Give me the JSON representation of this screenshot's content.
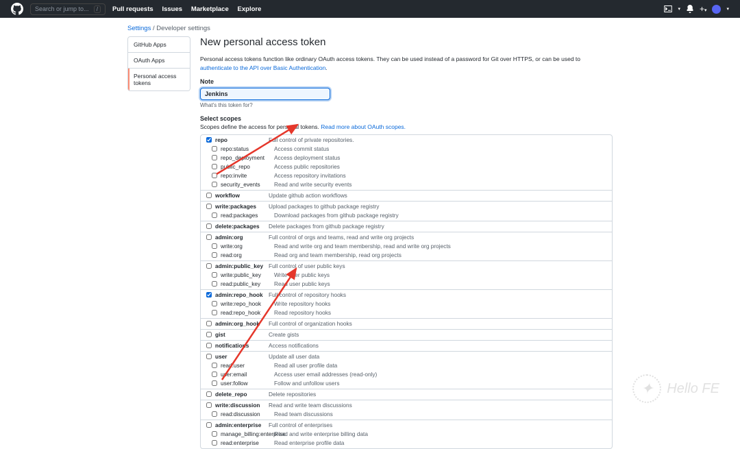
{
  "header": {
    "search_placeholder": "Search or jump to...",
    "nav": [
      "Pull requests",
      "Issues",
      "Marketplace",
      "Explore"
    ]
  },
  "breadcrumb": {
    "settings": "Settings",
    "sep": "/",
    "current": "Developer settings"
  },
  "sidebar": {
    "items": [
      "GitHub Apps",
      "OAuth Apps",
      "Personal access tokens"
    ]
  },
  "page": {
    "title": "New personal access token",
    "desc1": "Personal access tokens function like ordinary OAuth access tokens. They can be used instead of a password for Git over HTTPS, or can be used to ",
    "desc_link": "authenticate to the API over Basic Authentication",
    "desc_end": ".",
    "note_label": "Note",
    "note_value": "Jenkins",
    "note_hint": "What's this token for?",
    "select_scopes": "Select scopes",
    "scopes_desc": "Scopes define the access for personal tokens. ",
    "scopes_link": "Read more about OAuth scopes."
  },
  "scopes": [
    {
      "name": "repo",
      "desc": "Full control of private repositories.",
      "checked": true,
      "children": [
        {
          "name": "repo:status",
          "desc": "Access commit status"
        },
        {
          "name": "repo_deployment",
          "desc": "Access deployment status"
        },
        {
          "name": "public_repo",
          "desc": "Access public repositories"
        },
        {
          "name": "repo:invite",
          "desc": "Access repository invitations"
        },
        {
          "name": "security_events",
          "desc": "Read and write security events"
        }
      ]
    },
    {
      "name": "workflow",
      "desc": "Update github action workflows"
    },
    {
      "name": "write:packages",
      "desc": "Upload packages to github package registry",
      "children": [
        {
          "name": "read:packages",
          "desc": "Download packages from github package registry"
        }
      ]
    },
    {
      "name": "delete:packages",
      "desc": "Delete packages from github package registry"
    },
    {
      "name": "admin:org",
      "desc": "Full control of orgs and teams, read and write org projects",
      "children": [
        {
          "name": "write:org",
          "desc": "Read and write org and team membership, read and write org projects"
        },
        {
          "name": "read:org",
          "desc": "Read org and team membership, read org projects"
        }
      ]
    },
    {
      "name": "admin:public_key",
      "desc": "Full control of user public keys",
      "children": [
        {
          "name": "write:public_key",
          "desc": "Write user public keys"
        },
        {
          "name": "read:public_key",
          "desc": "Read user public keys"
        }
      ]
    },
    {
      "name": "admin:repo_hook",
      "desc": "Full control of repository hooks",
      "checked": true,
      "children": [
        {
          "name": "write:repo_hook",
          "desc": "Write repository hooks"
        },
        {
          "name": "read:repo_hook",
          "desc": "Read repository hooks"
        }
      ]
    },
    {
      "name": "admin:org_hook",
      "desc": "Full control of organization hooks"
    },
    {
      "name": "gist",
      "desc": "Create gists"
    },
    {
      "name": "notifications",
      "desc": "Access notifications"
    },
    {
      "name": "user",
      "desc": "Update all user data",
      "children": [
        {
          "name": "read:user",
          "desc": "Read all user profile data"
        },
        {
          "name": "user:email",
          "desc": "Access user email addresses (read-only)"
        },
        {
          "name": "user:follow",
          "desc": "Follow and unfollow users"
        }
      ]
    },
    {
      "name": "delete_repo",
      "desc": "Delete repositories"
    },
    {
      "name": "write:discussion",
      "desc": "Read and write team discussions",
      "children": [
        {
          "name": "read:discussion",
          "desc": "Read team discussions"
        }
      ]
    },
    {
      "name": "admin:enterprise",
      "desc": "Full control of enterprises",
      "children": [
        {
          "name": "manage_billing:enterprise",
          "desc": "Read and write enterprise billing data"
        },
        {
          "name": "read:enterprise",
          "desc": "Read enterprise profile data"
        }
      ]
    }
  ]
}
